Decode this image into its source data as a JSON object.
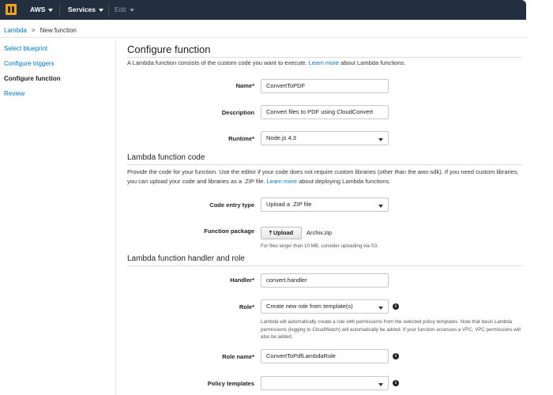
{
  "topbar": {
    "aws_label": "AWS",
    "services_label": "Services",
    "edit_label": "Edit"
  },
  "breadcrumb": {
    "root": "Lambda",
    "separator": ">",
    "current": "New function"
  },
  "sidebar": {
    "items": [
      {
        "label": "Select blueprint"
      },
      {
        "label": "Configure triggers"
      },
      {
        "label": "Configure function"
      },
      {
        "label": "Review"
      }
    ],
    "active_index": 2
  },
  "configure": {
    "title": "Configure function",
    "intro_before": "A Lambda function consists of the custom code you want to execute. ",
    "intro_link": "Learn more",
    "intro_after": " about Lambda functions.",
    "name_label": "Name*",
    "name_value": "ConvertToPDF",
    "description_label": "Description",
    "description_value": "Convert files to PDF using CloudConvert",
    "runtime_label": "Runtime*",
    "runtime_value": "Node.js 4.3"
  },
  "code": {
    "title": "Lambda function code",
    "para_before": "Provide the code for your function. Use the editor if your code does not require custom libraries (other than the aws-sdk). If you need custom libraries, you can upload your code and libraries as a .ZIP file. ",
    "para_link": "Learn more",
    "para_after": " about deploying Lambda functions.",
    "entry_type_label": "Code entry type",
    "entry_type_value": "Upload a .ZIP file",
    "package_label": "Function package",
    "upload_label": "Upload",
    "file_name": "Archiv.zip",
    "size_hint": "For files larger than 10 MB, consider uploading via S3."
  },
  "handler": {
    "title": "Lambda function handler and role",
    "handler_label": "Handler*",
    "handler_value": "convert.handler",
    "role_label": "Role*",
    "role_value": "Create new role from template(s)",
    "role_hint": "Lambda will automatically create a role with permissions from the selected policy templates. Note that basic Lambda permissions (logging to CloudWatch) will automatically be added. If your function accesses a VPC, VPC permissions will also be added.",
    "role_name_label": "Role name*",
    "role_name_value": "ConvertToPdfLambdaRole",
    "policy_label": "Policy templates",
    "policy_value": ""
  },
  "icons": {
    "logo": "aws-cube-icon",
    "info": "info-icon",
    "upload": "upload-icon",
    "dropdown": "chevron-down-icon"
  },
  "colors": {
    "topbar": "#232f3e",
    "logo": "#f7a21a",
    "link": "#0073bb"
  }
}
